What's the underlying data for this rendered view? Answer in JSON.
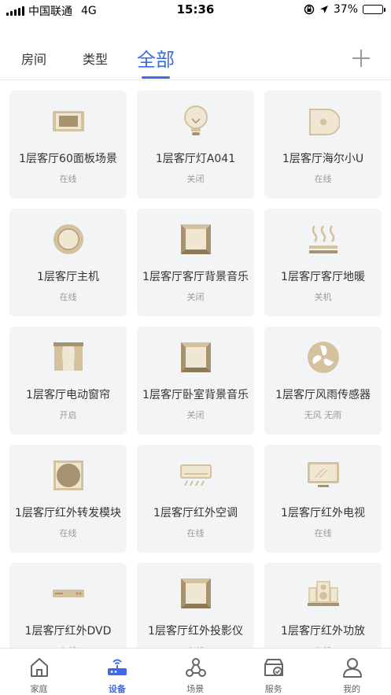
{
  "status_bar": {
    "carrier": "中国联通",
    "network": "4G",
    "time": "15:36",
    "battery": "37%",
    "battery_level": 0.37
  },
  "tabs": {
    "rooms": "房间",
    "types": "类型",
    "all": "全部",
    "active": "全部"
  },
  "devices": [
    {
      "name": "1层客厅60面板场景",
      "status": "在线",
      "icon": "panel-icon"
    },
    {
      "name": "1层客厅灯A041",
      "status": "关闭",
      "icon": "bulb-icon"
    },
    {
      "name": "1层客厅海尔小U",
      "status": "在线",
      "icon": "speaker-icon"
    },
    {
      "name": "1层客厅主机",
      "status": "在线",
      "icon": "host-icon"
    },
    {
      "name": "1层客厅客厅背景音乐",
      "status": "关闭",
      "icon": "music-box-icon"
    },
    {
      "name": "1层客厅客厅地暖",
      "status": "关机",
      "icon": "floor-heating-icon"
    },
    {
      "name": "1层客厅电动窗帘",
      "status": "开启",
      "icon": "curtain-icon"
    },
    {
      "name": "1层客厅卧室背景音乐",
      "status": "关闭",
      "icon": "music-box-icon"
    },
    {
      "name": "1层客厅风雨传感器",
      "status": "无风 无雨",
      "icon": "wind-sensor-icon"
    },
    {
      "name": "1层客厅红外转发模块",
      "status": "在线",
      "icon": "ir-module-icon"
    },
    {
      "name": "1层客厅红外空调",
      "status": "在线",
      "icon": "air-conditioner-icon"
    },
    {
      "name": "1层客厅红外电视",
      "status": "在线",
      "icon": "tv-icon"
    },
    {
      "name": "1层客厅红外DVD",
      "status": "在线",
      "icon": "dvd-icon"
    },
    {
      "name": "1层客厅红外投影仪",
      "status": "在线",
      "icon": "projector-icon"
    },
    {
      "name": "1层客厅红外功放",
      "status": "在线",
      "icon": "amplifier-icon"
    }
  ],
  "bottom_nav": [
    {
      "label": "家庭",
      "icon": "home-icon",
      "active": false
    },
    {
      "label": "设备",
      "icon": "router-icon",
      "active": true
    },
    {
      "label": "场景",
      "icon": "scene-icon",
      "active": false
    },
    {
      "label": "服务",
      "icon": "service-icon",
      "active": false
    },
    {
      "label": "我的",
      "icon": "profile-icon",
      "active": false
    }
  ],
  "colors": {
    "accent": "#3d6be6",
    "card_bg": "#f3f4f6",
    "icon_gold": "#d4c29f",
    "icon_cream": "#efe7d2",
    "icon_dark": "#a89370"
  }
}
